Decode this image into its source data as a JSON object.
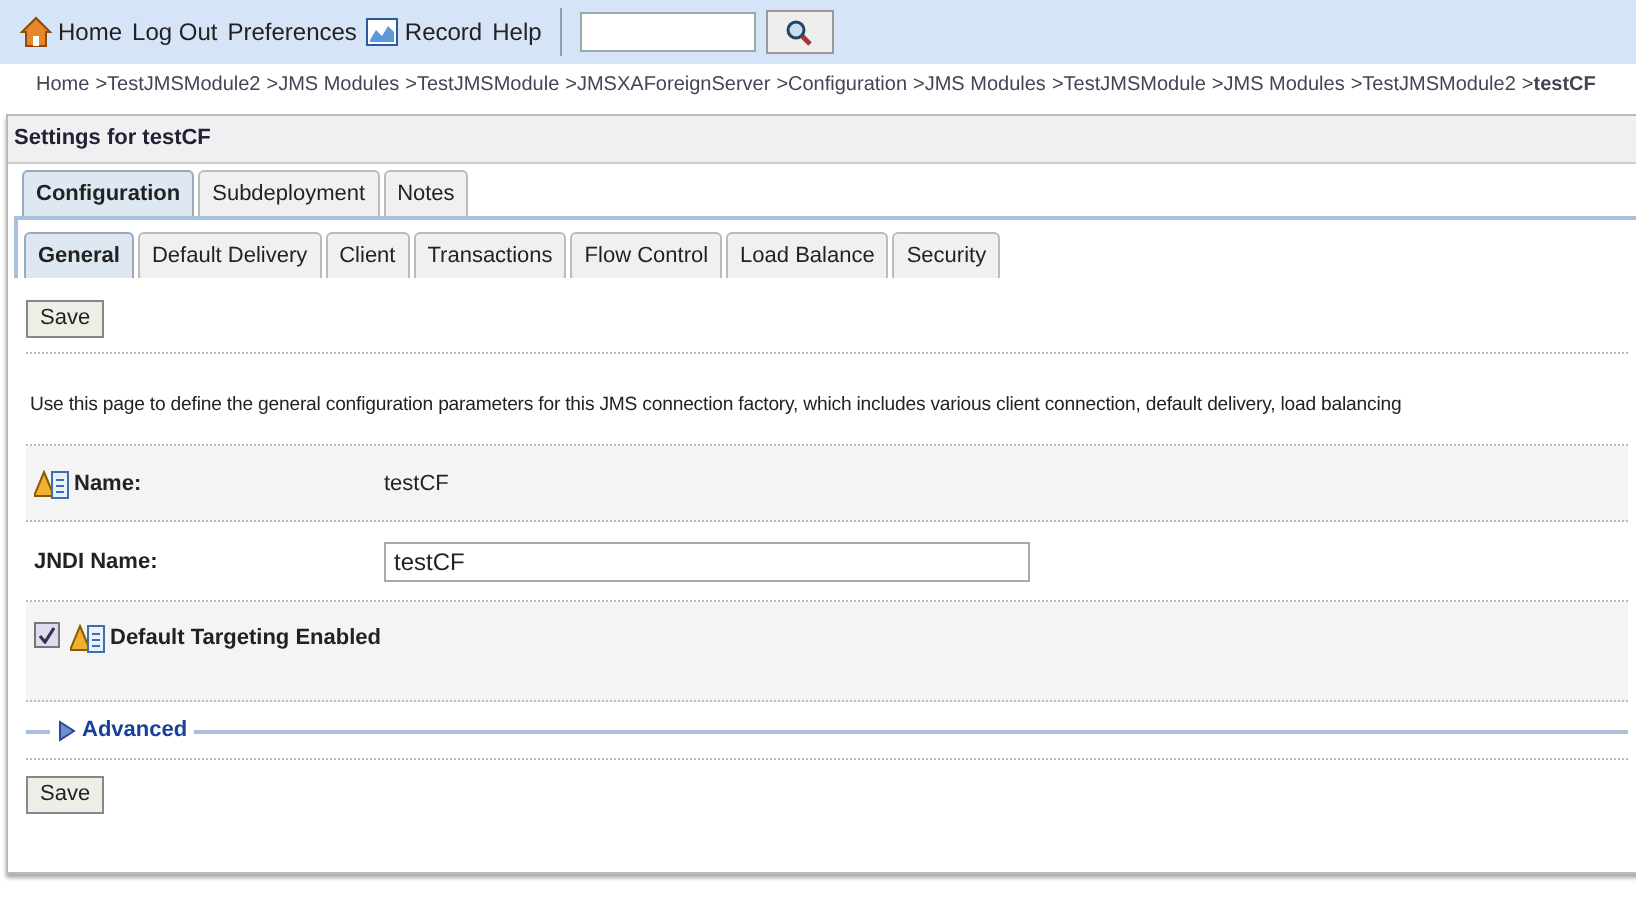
{
  "toolbar": {
    "items": [
      {
        "kind": "home",
        "label": "Home"
      },
      {
        "kind": "link",
        "label": "Log Out"
      },
      {
        "kind": "link",
        "label": "Preferences"
      },
      {
        "kind": "record",
        "label": "Record"
      },
      {
        "kind": "link",
        "label": "Help"
      }
    ]
  },
  "breadcrumb": [
    "Home",
    ">TestJMSModule2",
    ">JMS Modules",
    ">TestJMSModule",
    ">JMSXAForeignServer",
    ">Configuration",
    ">JMS Modules",
    ">TestJMSModule",
    ">JMS Modules",
    ">TestJMSModule2",
    ">**testCF**"
  ],
  "panel": {
    "title": "Settings for testCF",
    "tabs": [
      {
        "label": "Configuration",
        "selected": true
      },
      {
        "label": "Subdeployment",
        "selected": false
      },
      {
        "label": "Notes",
        "selected": false
      }
    ],
    "subtabs": [
      {
        "label": "General",
        "selected": true
      },
      {
        "label": "Default Delivery",
        "selected": false
      },
      {
        "label": "Client",
        "selected": false
      },
      {
        "label": "Transactions",
        "selected": false
      },
      {
        "label": "Flow Control",
        "selected": false
      },
      {
        "label": "Load Balance",
        "selected": false
      },
      {
        "label": "Security",
        "selected": false
      }
    ],
    "save_top": "Save",
    "description": "Use this page to define the general configuration parameters for this JMS connection factory, which includes various client connection, default delivery, load balancing",
    "fields": [
      {
        "kind": "readonly",
        "label": "Name:",
        "value": "testCF",
        "warning": true
      },
      {
        "kind": "text",
        "label": "JNDI Name:",
        "value": "testCF",
        "warning": false
      },
      {
        "kind": "checkbox",
        "label": "Default Targeting Enabled",
        "checked": true,
        "warning": true
      }
    ],
    "advanced": {
      "label": "Advanced",
      "expanded": false
    },
    "save_bottom": "Save"
  }
}
